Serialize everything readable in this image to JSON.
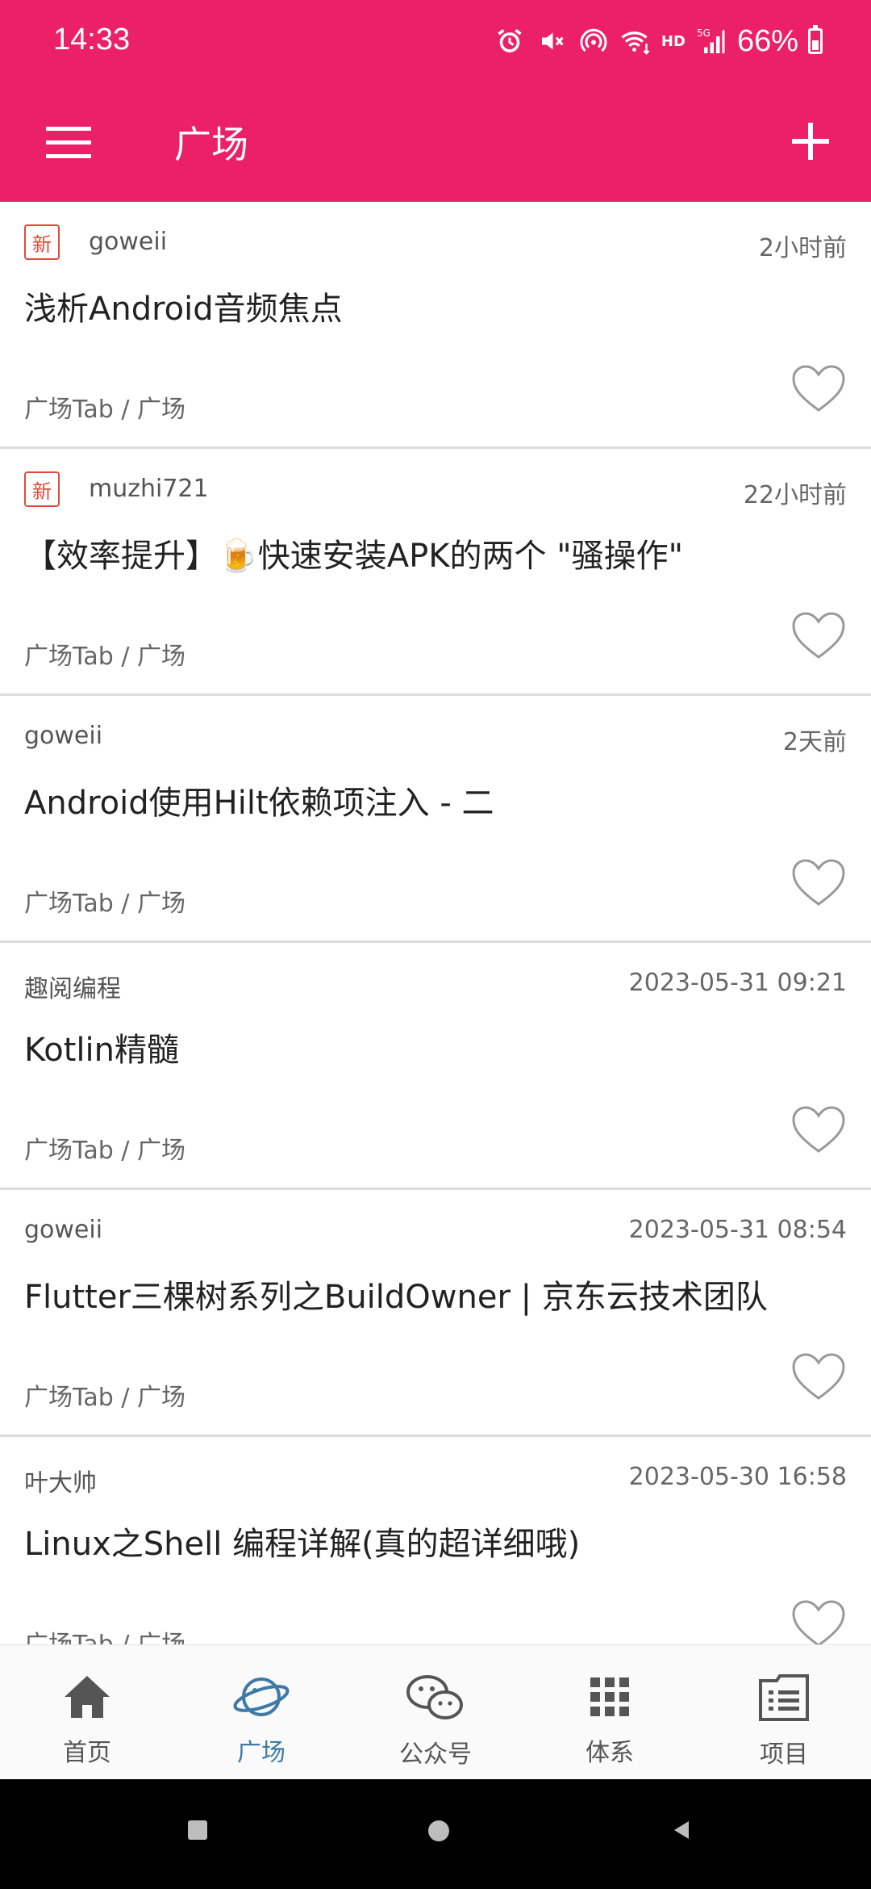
{
  "status_bar": {
    "time": "14:33",
    "hd": "HD",
    "battery": "66%",
    "icons": [
      "alarm-icon",
      "mute-icon",
      "hotspot-icon",
      "wifi-icon",
      "signal-icon",
      "battery-icon"
    ]
  },
  "toolbar": {
    "title": "广场",
    "menu_icon": "menu-icon",
    "add_icon": "plus-icon",
    "color": "#EC2067"
  },
  "articles": [
    {
      "is_new": true,
      "new_label": "新",
      "author": "goweii",
      "time": "2小时前",
      "title": "浅析Android音频焦点",
      "category": "广场Tab / 广场"
    },
    {
      "is_new": true,
      "new_label": "新",
      "author": "muzhi721",
      "time": "22小时前",
      "title": "【效率提升】🍺快速安装APK的两个 \"骚操作\"",
      "category": "广场Tab / 广场"
    },
    {
      "is_new": false,
      "author": "goweii",
      "time": "2天前",
      "title": "Android使用Hilt依赖项注入 - 二",
      "category": "广场Tab / 广场"
    },
    {
      "is_new": false,
      "author": "趣阅编程",
      "time": "2023-05-31 09:21",
      "title": "Kotlin精髓",
      "category": "广场Tab / 广场"
    },
    {
      "is_new": false,
      "author": "goweii",
      "time": "2023-05-31 08:54",
      "title": "Flutter三棵树系列之BuildOwner | 京东云技术团队",
      "category": "广场Tab / 广场"
    },
    {
      "is_new": false,
      "author": "叶大帅",
      "time": "2023-05-30 16:58",
      "title": "Linux之Shell 编程详解(真的超详细哦)",
      "category": "广场Tab / 广场"
    }
  ],
  "bottom_nav": [
    {
      "label": "首页",
      "icon": "home-icon",
      "active": false
    },
    {
      "label": "广场",
      "icon": "planet-icon",
      "active": true
    },
    {
      "label": "公众号",
      "icon": "wechat-icon",
      "active": false
    },
    {
      "label": "体系",
      "icon": "grid-icon",
      "active": false
    },
    {
      "label": "项目",
      "icon": "list-icon",
      "active": false
    }
  ],
  "colors": {
    "accent": "#EC2067",
    "active_nav": "#3E7AA5",
    "new_tag": "#E04A3A"
  }
}
